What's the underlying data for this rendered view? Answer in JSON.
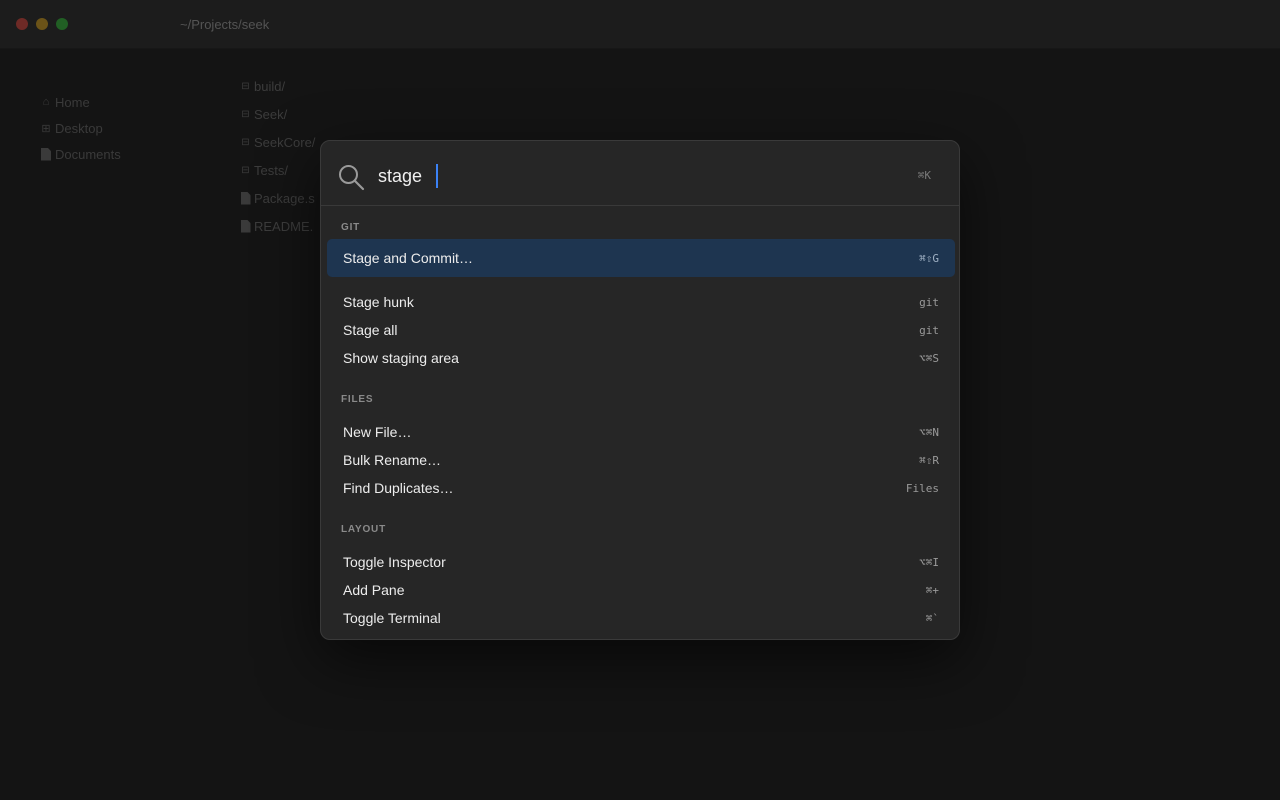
{
  "window": {
    "title": "~/Projects/seek"
  },
  "sidebar": {
    "items": [
      {
        "label": "Home",
        "icon": "home-icon"
      },
      {
        "label": "Desktop",
        "icon": "desktop-icon"
      },
      {
        "label": "Documents",
        "icon": "document-icon"
      }
    ]
  },
  "files": {
    "items": [
      {
        "label": "build/",
        "icon": "folder-icon"
      },
      {
        "label": "Seek/",
        "icon": "folder-icon"
      },
      {
        "label": "SeekCore/",
        "icon": "folder-icon"
      },
      {
        "label": "Tests/",
        "icon": "folder-icon"
      },
      {
        "label": "Package.s",
        "icon": "file-icon"
      },
      {
        "label": "README.",
        "icon": "file-icon"
      }
    ]
  },
  "palette": {
    "query": "stage",
    "shortcut_hint": "⌘K",
    "sections": [
      {
        "label": "GIT",
        "commands": [
          {
            "label": "Stage and Commit…",
            "shortcut": "⌘⇧G",
            "selected": true
          },
          {
            "label": "Stage hunk",
            "shortcut": "git"
          },
          {
            "label": "Stage all",
            "shortcut": "git"
          },
          {
            "label": "Show staging area",
            "shortcut": "⌥⌘S"
          }
        ]
      },
      {
        "label": "FILES",
        "commands": [
          {
            "label": "New File…",
            "shortcut": "⌥⌘N"
          },
          {
            "label": "Bulk Rename…",
            "shortcut": "⌘⇧R"
          },
          {
            "label": "Find Duplicates…",
            "shortcut": "Files"
          }
        ]
      },
      {
        "label": "LAYOUT",
        "commands": [
          {
            "label": "Toggle Inspector",
            "shortcut": "⌥⌘I"
          },
          {
            "label": "Add Pane",
            "shortcut": "⌘+"
          },
          {
            "label": "Toggle Terminal",
            "shortcut": "⌘`"
          }
        ]
      }
    ]
  },
  "colors": {
    "accent": "#3b82f6",
    "selection": "#1e3550"
  }
}
